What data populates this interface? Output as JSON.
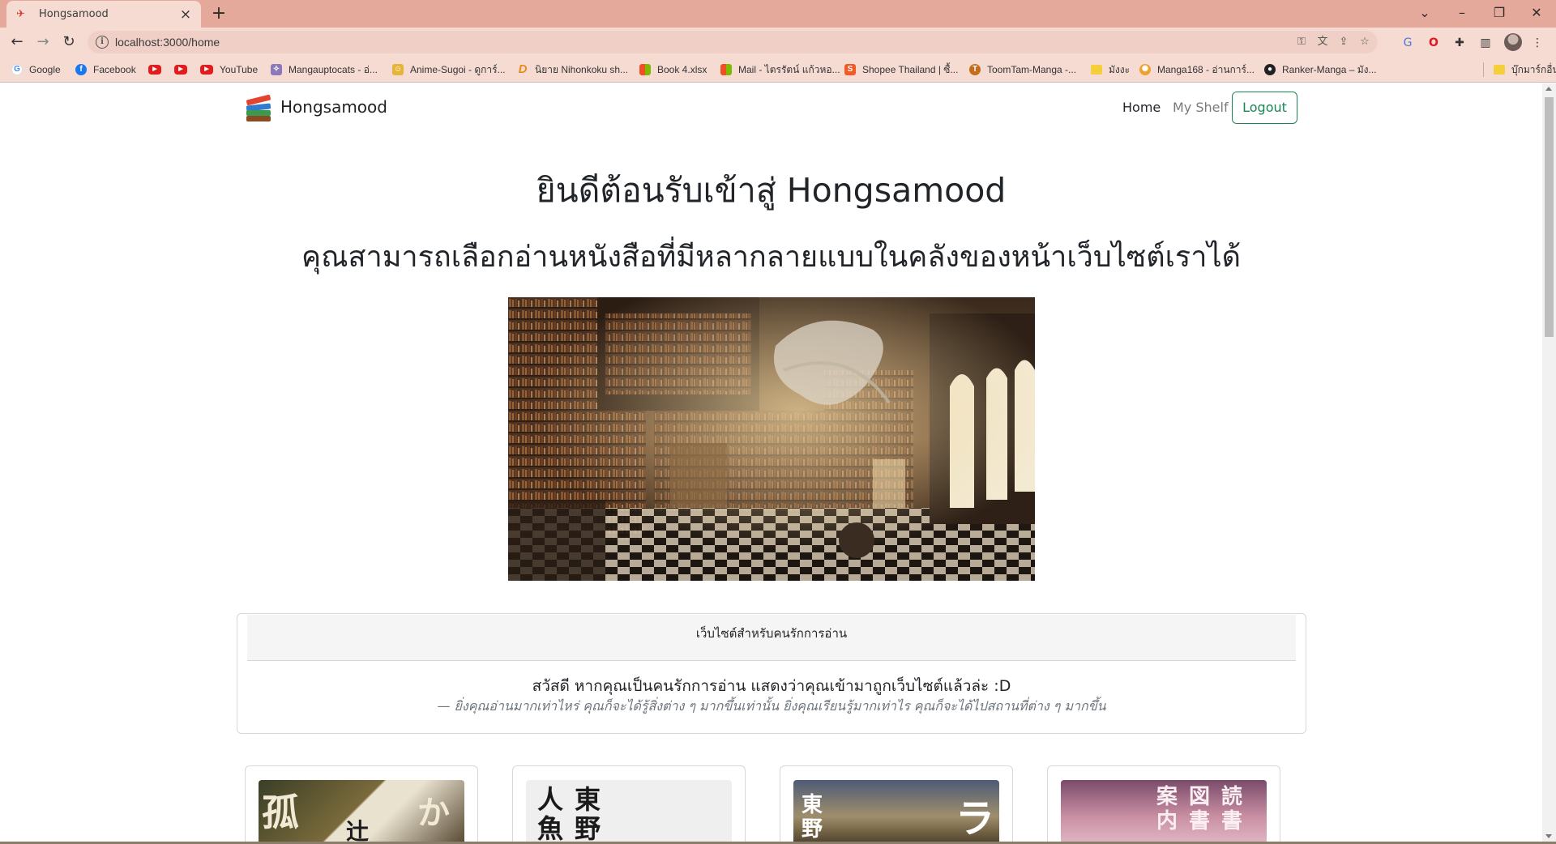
{
  "browser": {
    "tab_title": "Hongsamood",
    "url": "localhost:3000/home",
    "bookmarks": [
      {
        "label": "Google",
        "icon": "google-icon"
      },
      {
        "label": "Facebook",
        "icon": "facebook-icon"
      },
      {
        "label": "",
        "icon": "youtube-icon"
      },
      {
        "label": "",
        "icon": "youtube-icon"
      },
      {
        "label": "YouTube",
        "icon": "youtube-icon"
      },
      {
        "label": "Mangauptocats - อ่...",
        "icon": "manga-icon"
      },
      {
        "label": "Anime-Sugoi - ดูการ์...",
        "icon": "anime-icon"
      },
      {
        "label": "นิยาย Nihonkoku sh...",
        "icon": "d-icon"
      },
      {
        "label": "Book 4.xlsx",
        "icon": "office-icon"
      },
      {
        "label": "Mail - ไตรรัตน์ แก้วหอ...",
        "icon": "office-icon"
      },
      {
        "label": "Shopee Thailand | ซื้...",
        "icon": "shopee-icon"
      },
      {
        "label": "ToomTam-Manga -...",
        "icon": "toomtam-icon"
      },
      {
        "label": "มังงะ",
        "icon": "folder-icon"
      },
      {
        "label": "Manga168 - อ่านการ์...",
        "icon": "manga168-icon"
      },
      {
        "label": "Ranker-Manga – มัง...",
        "icon": "ranker-icon"
      }
    ],
    "other_bookmarks": "บุ๊กมาร์กอื่นๆ"
  },
  "nav": {
    "brand": "Hongsamood",
    "home": "Home",
    "shelf": "My Shelf",
    "logout": "Logout"
  },
  "welcome": {
    "title": "ยินดีต้อนรับเข้าสู่ Hongsamood",
    "subtitle": "คุณสามารถเลือกอ่านหนังสือที่มีหลากลายแบบในคลังของหน้าเว็บไซต์เราได้"
  },
  "card": {
    "header": "เว็บไซต์สำหรับคนรักการอ่าน",
    "quote": "สวัสดี หากคุณเป็นคนรักการอ่าน แสดงว่าคุณเข้ามาถูกเว็บไซต์แล้วล่ะ :D",
    "footer": "—  ยิ่งคุณอ่านมากเท่าไหร่ คุณก็จะได้รู้สิ่งต่าง ๆ มากขึ้นเท่านั้น ยิ่งคุณเรียนรู้มากเท่าไร คุณก็จะได้ไปสถานที่ต่าง ๆ มากขึ้น"
  },
  "books": [
    {
      "cover_text_a": "孤",
      "cover_text_b": "辻",
      "cover_text_c": "か"
    },
    {
      "cover_text_a": "人魚",
      "cover_text_b": "東野"
    },
    {
      "cover_text_a": "東野",
      "cover_text_b": "ラ"
    },
    {
      "cover_text_a": "案内",
      "cover_text_b": "図書",
      "cover_text_c": "読書"
    }
  ]
}
